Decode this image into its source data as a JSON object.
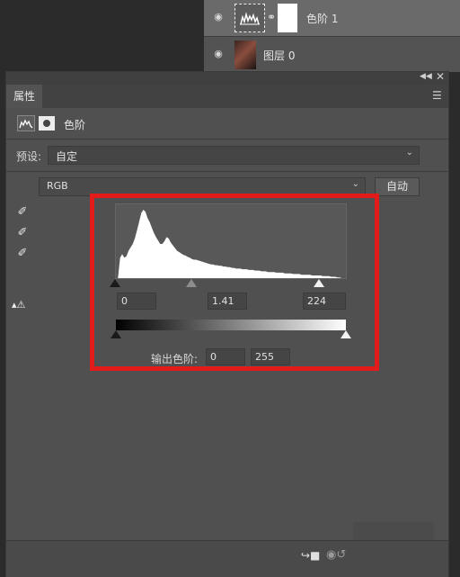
{
  "layers": [
    {
      "name": "色阶 1",
      "selected": true,
      "type": "adjustment"
    },
    {
      "name": "图层 0",
      "selected": false,
      "type": "image"
    }
  ],
  "panel": {
    "tab_label": "属性",
    "adjustment_title": "色阶",
    "preset_label": "预设:",
    "preset_value": "自定",
    "channel_value": "RGB",
    "auto_button": "自动",
    "input_black": "0",
    "input_gamma": "1.41",
    "input_white": "224",
    "output_label": "输出色阶:",
    "output_black": "0",
    "output_white": "255",
    "input_black_fraction": 0.0,
    "input_gamma_fraction": 0.33,
    "input_white_fraction": 0.878,
    "output_black_fraction": 0.0,
    "output_white_fraction": 1.0
  },
  "highlight_color": "#e21b1b",
  "histogram": [
    0,
    0,
    0.3,
    0.35,
    0.3,
    0.32,
    0.4,
    0.45,
    0.5,
    0.58,
    0.7,
    0.82,
    0.95,
    1.0,
    0.97,
    0.88,
    0.82,
    0.74,
    0.66,
    0.6,
    0.55,
    0.5,
    0.5,
    0.54,
    0.6,
    0.58,
    0.52,
    0.48,
    0.44,
    0.4,
    0.38,
    0.36,
    0.34,
    0.33,
    0.31,
    0.3,
    0.28,
    0.27,
    0.27,
    0.26,
    0.25,
    0.24,
    0.23,
    0.22,
    0.21,
    0.2,
    0.2,
    0.19,
    0.19,
    0.18,
    0.18,
    0.17,
    0.17,
    0.16,
    0.16,
    0.15,
    0.15,
    0.14,
    0.14,
    0.14,
    0.13,
    0.13,
    0.13,
    0.12,
    0.12,
    0.12,
    0.11,
    0.11,
    0.11,
    0.1,
    0.1,
    0.1,
    0.09,
    0.09,
    0.09,
    0.09,
    0.08,
    0.08,
    0.08,
    0.08,
    0.07,
    0.07,
    0.07,
    0.07,
    0.06,
    0.06,
    0.06,
    0.06,
    0.05,
    0.05,
    0.05,
    0.05,
    0.05,
    0.04,
    0.04,
    0.04,
    0.04,
    0.04,
    0.03,
    0.03,
    0.03,
    0.03,
    0.02,
    0.02,
    0.02,
    0.01,
    0.01,
    0,
    0,
    0
  ]
}
